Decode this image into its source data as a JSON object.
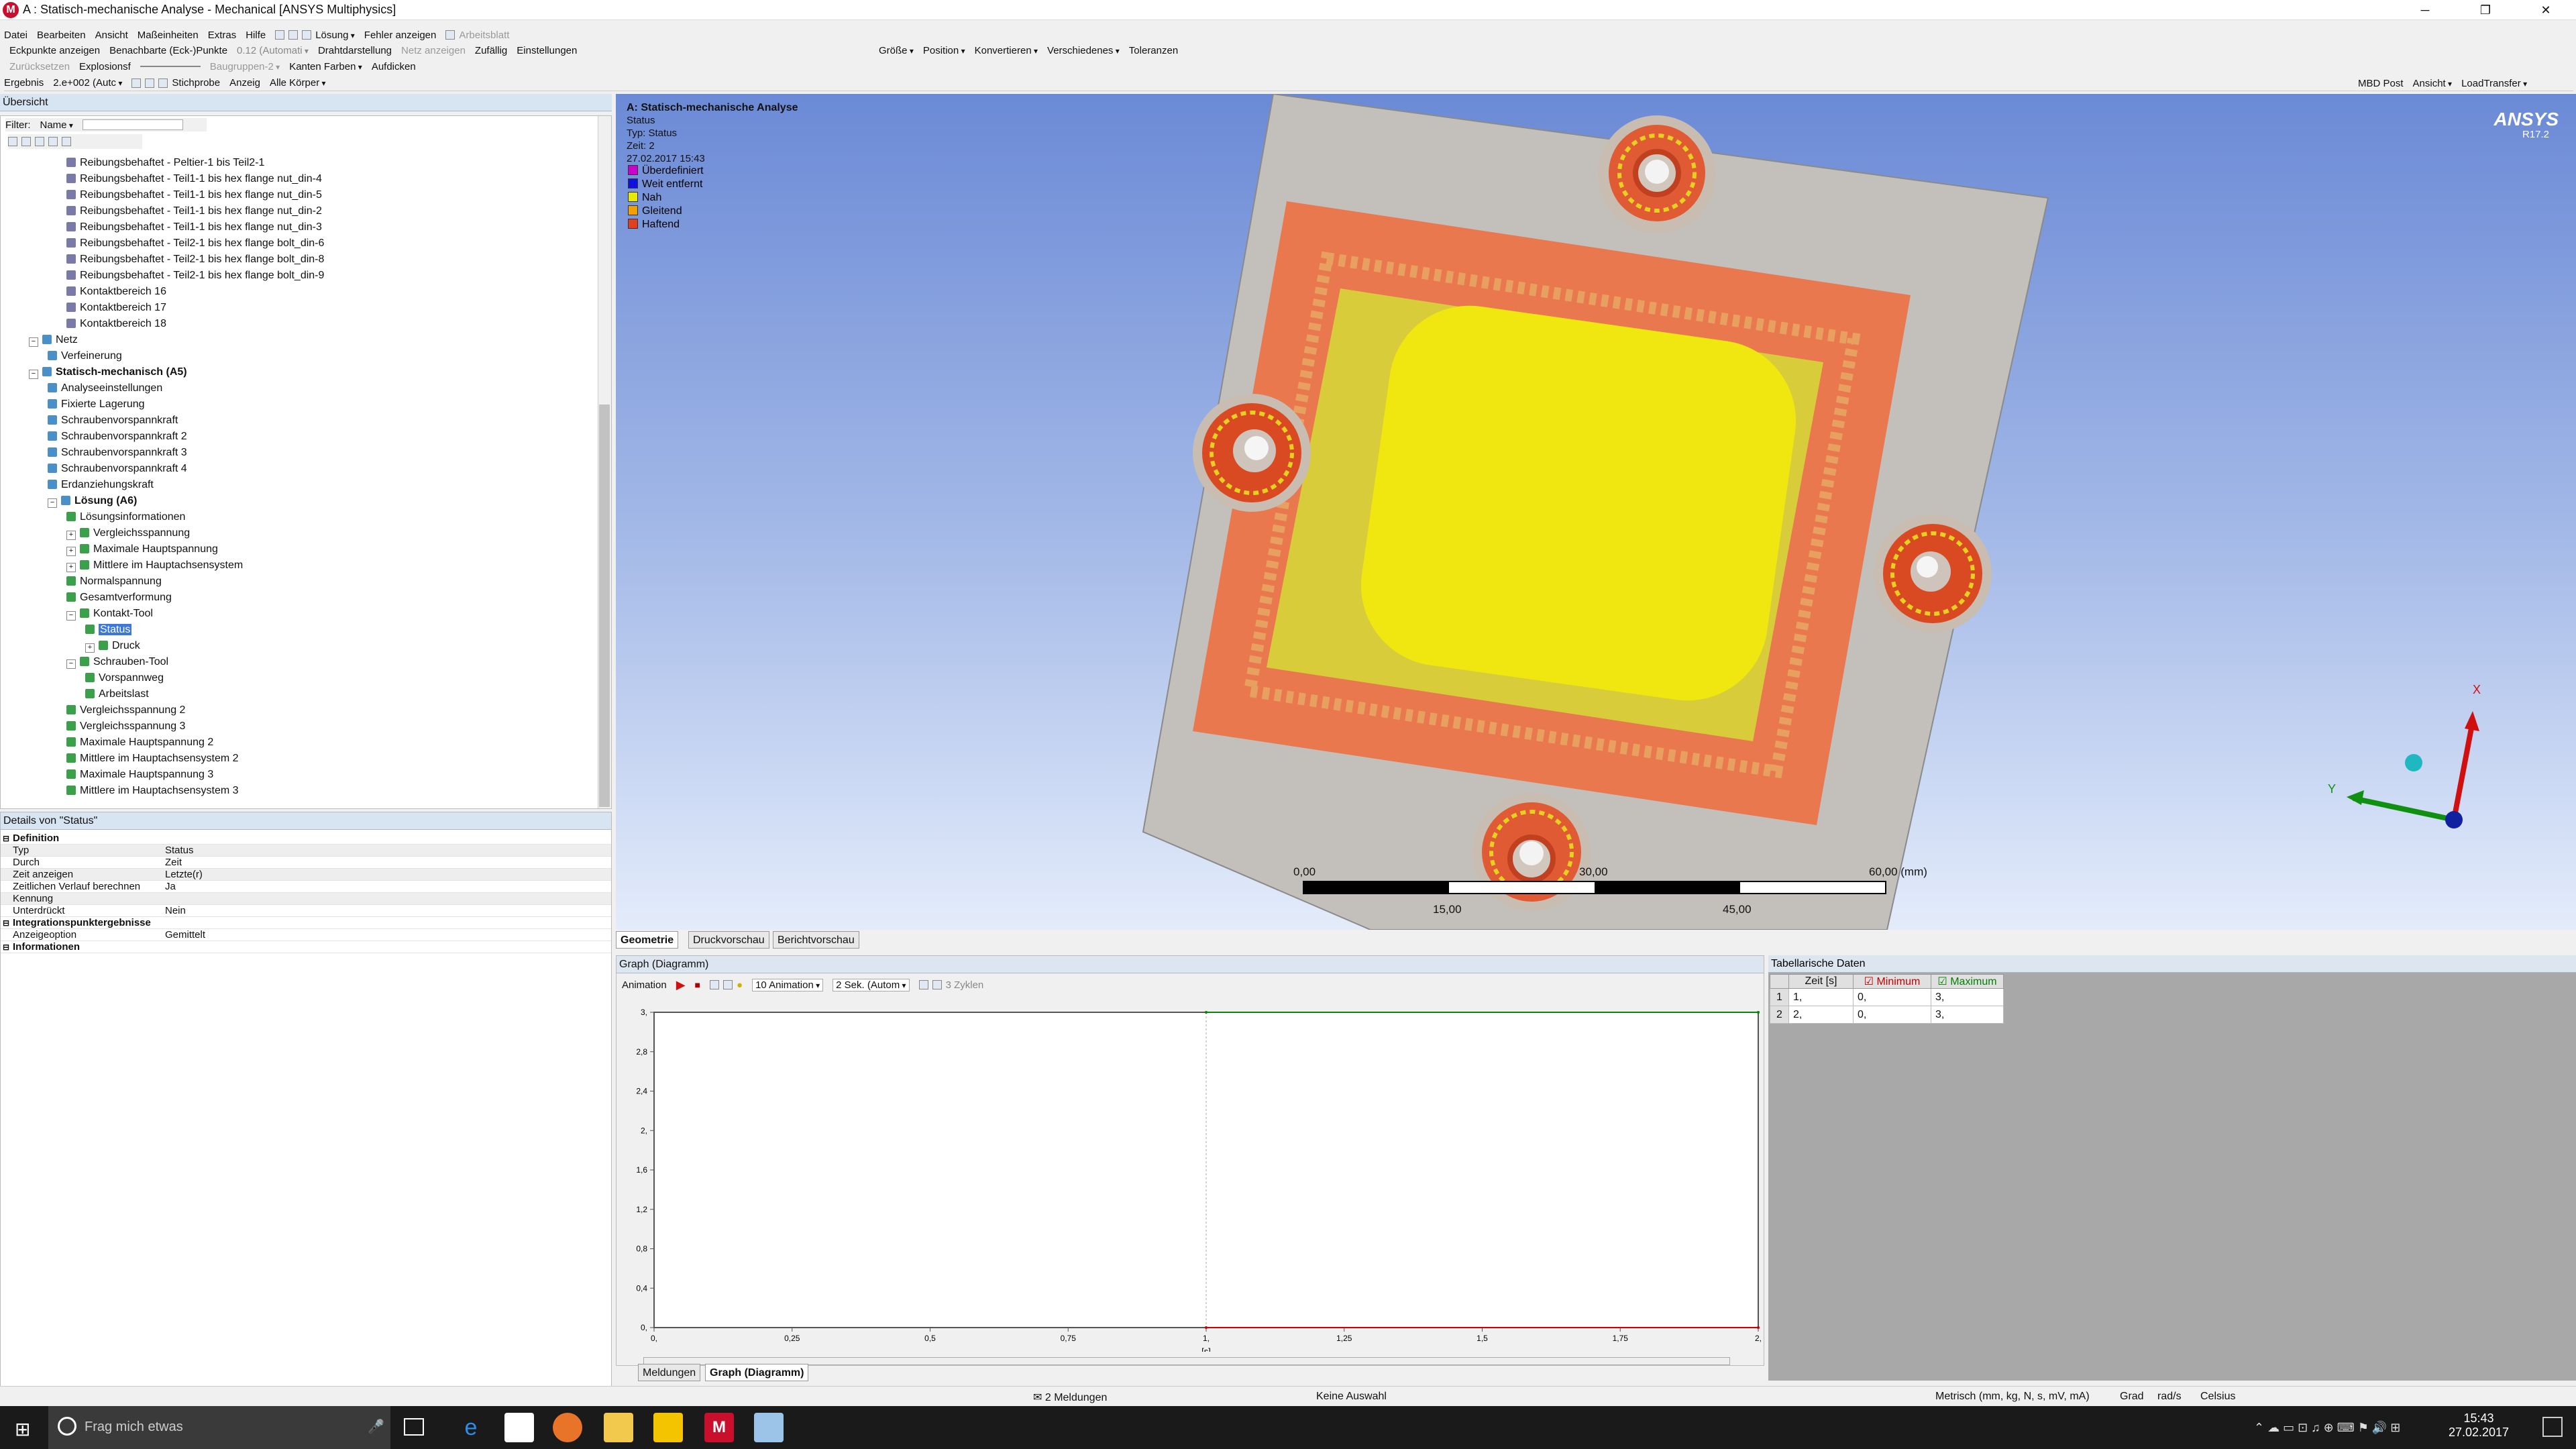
{
  "window": {
    "title": "A : Statisch-mechanische Analyse - Mechanical [ANSYS Multiphysics]",
    "app_icon_letter": "M",
    "controls": [
      "─",
      "❐",
      "✕"
    ]
  },
  "menubar": {
    "items": [
      "Datei",
      "Bearbeiten",
      "Ansicht",
      "Maßeinheiten",
      "Extras",
      "Hilfe"
    ],
    "solve_label": "Lösung",
    "errors_label": "Fehler anzeigen",
    "worksheet_label": "Arbeitsblatt"
  },
  "toolbar2": {
    "items": [
      "Eckpunkte anzeigen",
      "Benachbarte (Eck-)Punkte",
      "0.12 (Automati",
      "Drahtdarstellung",
      "Netz anzeigen",
      "Zufällig",
      "Einstellungen"
    ],
    "right_items": [
      "Größe",
      "Position",
      "Konvertieren",
      "Verschiedenes",
      "Toleranzen"
    ]
  },
  "toolbar3": {
    "items": [
      "Zurücksetzen",
      "Explosionsf",
      "Baugruppen-2",
      "Kanten Farben",
      "Aufdicken"
    ]
  },
  "toolbar4": {
    "result_label": "Ergebnis",
    "result_value": "2.e+002 (Autc",
    "probe_label": "Stichprobe",
    "show_label": "Anzeig",
    "show_value": "Alle Körper",
    "mbd_label": "MBD Post",
    "view_label": "Ansicht",
    "load_label": "LoadTransfer"
  },
  "outline": {
    "header": "Übersicht",
    "filter_label": "Filter:",
    "filter_value": "Name",
    "items": [
      {
        "label": "Reibungsbehaftet - Peltier-1 bis Teil2-1",
        "level": 4
      },
      {
        "label": "Reibungsbehaftet - Teil1-1 bis hex flange nut_din-4",
        "level": 4
      },
      {
        "label": "Reibungsbehaftet - Teil1-1 bis hex flange nut_din-5",
        "level": 4
      },
      {
        "label": "Reibungsbehaftet - Teil1-1 bis hex flange nut_din-2",
        "level": 4
      },
      {
        "label": "Reibungsbehaftet - Teil1-1 bis hex flange nut_din-3",
        "level": 4
      },
      {
        "label": "Reibungsbehaftet - Teil2-1 bis hex flange bolt_din-6",
        "level": 4
      },
      {
        "label": "Reibungsbehaftet - Teil2-1 bis hex flange bolt_din-8",
        "level": 4
      },
      {
        "label": "Reibungsbehaftet - Teil2-1 bis hex flange bolt_din-9",
        "level": 4
      },
      {
        "label": "Kontaktbereich 16",
        "level": 4
      },
      {
        "label": "Kontaktbereich 17",
        "level": 4
      },
      {
        "label": "Kontaktbereich 18",
        "level": 4
      },
      {
        "label": "Netz",
        "level": 2
      },
      {
        "label": "Verfeinerung",
        "level": 3
      },
      {
        "label": "Statisch-mechanisch (A5)",
        "level": 2
      },
      {
        "label": "Analyseeinstellungen",
        "level": 3
      },
      {
        "label": "Fixierte Lagerung",
        "level": 3
      },
      {
        "label": "Schraubenvorspannkraft",
        "level": 3
      },
      {
        "label": "Schraubenvorspannkraft 2",
        "level": 3
      },
      {
        "label": "Schraubenvorspannkraft 3",
        "level": 3
      },
      {
        "label": "Schraubenvorspannkraft 4",
        "level": 3
      },
      {
        "label": "Erdanziehungskraft",
        "level": 3
      },
      {
        "label": "Lösung (A6)",
        "level": 3
      },
      {
        "label": "Lösungsinformationen",
        "level": 4
      },
      {
        "label": "Vergleichsspannung",
        "level": 4
      },
      {
        "label": "Maximale Hauptspannung",
        "level": 4
      },
      {
        "label": "Mittlere im Hauptachsensystem",
        "level": 4
      },
      {
        "label": "Normalspannung",
        "level": 4
      },
      {
        "label": "Gesamtverformung",
        "level": 4
      },
      {
        "label": "Kontakt-Tool",
        "level": 4
      },
      {
        "label": "Status",
        "level": 5
      },
      {
        "label": "Druck",
        "level": 5
      },
      {
        "label": "Schrauben-Tool",
        "level": 4
      },
      {
        "label": "Vorspannweg",
        "level": 5
      },
      {
        "label": "Arbeitslast",
        "level": 5
      },
      {
        "label": "Vergleichsspannung 2",
        "level": 4
      },
      {
        "label": "Vergleichsspannung 3",
        "level": 4
      },
      {
        "label": "Maximale Hauptspannung 2",
        "level": 4
      },
      {
        "label": "Mittlere im Hauptachsensystem 2",
        "level": 4
      },
      {
        "label": "Maximale Hauptspannung 3",
        "level": 4
      },
      {
        "label": "Mittlere im Hauptachsensystem 3",
        "level": 4
      }
    ]
  },
  "details": {
    "header": "Details von \"Status\"",
    "rows": [
      {
        "key": "Definition",
        "value": "",
        "section": true
      },
      {
        "key": "Typ",
        "value": "Status"
      },
      {
        "key": "Durch",
        "value": "Zeit"
      },
      {
        "key": "Zeit anzeigen",
        "value": "Letzte(r)"
      },
      {
        "key": "Zeitlichen Verlauf berechnen",
        "value": "Ja"
      },
      {
        "key": "Kennung",
        "value": ""
      },
      {
        "key": "Unterdrückt",
        "value": "Nein"
      },
      {
        "key": "Integrationspunktergebnisse",
        "value": "",
        "section": true
      },
      {
        "key": "Anzeigeoption",
        "value": "Gemittelt"
      },
      {
        "key": "Informationen",
        "value": "",
        "section": true
      }
    ]
  },
  "viewport": {
    "title": "A: Statisch-mechanische Analyse",
    "lines": [
      "Status",
      "Typ: Status",
      "Zeit: 2",
      "27.02.2017 15:43"
    ],
    "legend": [
      {
        "label": "Überdefiniert",
        "color": "#cc00cc"
      },
      {
        "label": "Weit entfernt",
        "color": "#1010e0"
      },
      {
        "label": "Nah",
        "color": "#e8e800"
      },
      {
        "label": "Gleitend",
        "color": "#f0a000"
      },
      {
        "label": "Haftend",
        "color": "#e04020"
      }
    ],
    "brand": "ANSYS",
    "version": "R17.2",
    "scale_top": [
      "0,00",
      "30,00",
      "60,00 (mm)"
    ],
    "scale_bottom": [
      "15,00",
      "45,00"
    ],
    "axes": {
      "x": "X",
      "y": "Y"
    }
  },
  "view_tabs": [
    "Geometrie",
    "Druckvorschau",
    "Berichtvorschau"
  ],
  "graph": {
    "header": "Graph (Diagramm)",
    "animation_label": "Animation",
    "frames": "10 Animation",
    "speed": "2 Sek. (Autom",
    "cycles": "3 Zyklen",
    "bottom_tabs": [
      "Meldungen",
      "Graph (Diagramm)"
    ]
  },
  "chart_data": {
    "type": "line",
    "x_ticks": [
      "0,",
      "0,25",
      "0,5",
      "0,75",
      "1,",
      "1,25",
      "1,5",
      "1,75",
      "2,"
    ],
    "y_ticks": [
      "0,",
      "0,4",
      "0,8",
      "1,2",
      "1,6",
      "2,",
      "2,4",
      "2,8",
      "3,"
    ],
    "xlabel": "[s]",
    "x_range": [
      0,
      2
    ],
    "y_range": [
      0,
      3
    ],
    "step_labels": [
      "1",
      "2"
    ],
    "series": [
      {
        "name": "Minimum",
        "x": [
          1,
          2
        ],
        "values": [
          0,
          0
        ],
        "color": "#cc0000"
      },
      {
        "name": "Maximum",
        "x": [
          1,
          2
        ],
        "values": [
          3,
          3
        ],
        "color": "#008800"
      }
    ]
  },
  "table": {
    "header": "Tabellarische Daten",
    "columns": [
      "Zeit [s]",
      "Minimum",
      "Maximum"
    ],
    "rows": [
      [
        "1",
        "1,",
        "0,",
        "3,"
      ],
      [
        "2",
        "2,",
        "0,",
        "3,"
      ]
    ]
  },
  "statusbar": {
    "messages": "2 Meldungen",
    "selection": "Keine Auswahl",
    "units": "Metrisch (mm, kg, N, s, mV, mA)",
    "angle": "Grad",
    "rot": "rad/s",
    "temp": "Celsius"
  },
  "taskbar": {
    "search_placeholder": "Frag mich etwas",
    "time": "15:43",
    "date": "27.02.2017"
  }
}
